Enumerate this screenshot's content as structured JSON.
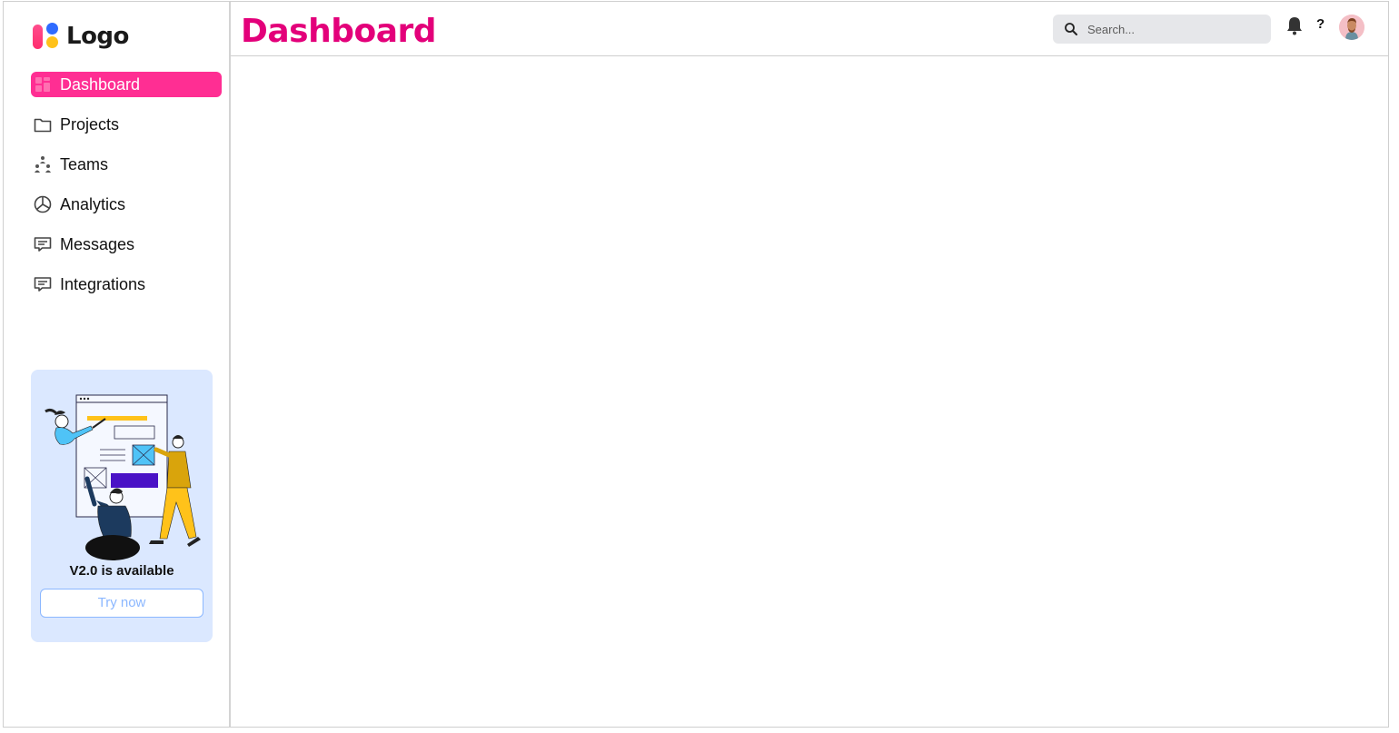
{
  "logo": {
    "text": "Logo"
  },
  "sidebar": {
    "items": [
      {
        "label": "Dashboard",
        "icon": "grid-icon",
        "active": true
      },
      {
        "label": "Projects",
        "icon": "folder-icon",
        "active": false
      },
      {
        "label": "Teams",
        "icon": "team-icon",
        "active": false
      },
      {
        "label": "Analytics",
        "icon": "pie-chart-icon",
        "active": false
      },
      {
        "label": "Messages",
        "icon": "message-icon",
        "active": false
      },
      {
        "label": "Integrations",
        "icon": "message-icon",
        "active": false
      }
    ]
  },
  "promo": {
    "title": "V2.0 is available",
    "button_label": "Try now"
  },
  "header": {
    "title": "Dashboard",
    "search_placeholder": "Search...",
    "help_label": "?"
  },
  "colors": {
    "accent": "#ff2e93",
    "title": "#e3007a",
    "promo_bg": "#dbe8ff",
    "promo_button": "#8bb7ff"
  }
}
